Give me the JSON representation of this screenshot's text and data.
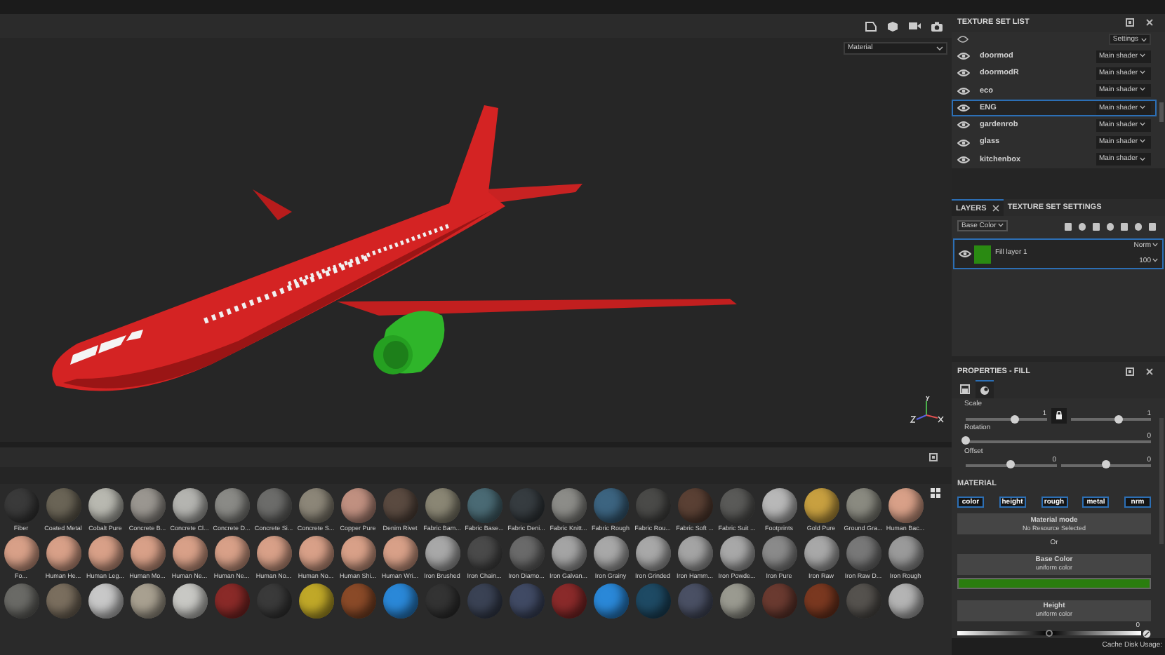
{
  "viewport": {
    "channel_select": "Material"
  },
  "texture_set_list": {
    "title": "TEXTURE SET LIST",
    "settings": "Settings",
    "items": [
      {
        "name": "doormod",
        "shader": "Main shader",
        "selected": false
      },
      {
        "name": "doormodR",
        "shader": "Main shader",
        "selected": false
      },
      {
        "name": "eco",
        "shader": "Main shader",
        "selected": false
      },
      {
        "name": "ENG",
        "shader": "Main shader",
        "selected": true
      },
      {
        "name": "gardenrob",
        "shader": "Main shader",
        "selected": false
      },
      {
        "name": "glass",
        "shader": "Main shader",
        "selected": false
      },
      {
        "name": "kitchenbox",
        "shader": "Main shader",
        "selected": false
      }
    ]
  },
  "layers": {
    "tabs": [
      {
        "label": "LAYERS",
        "selected": true
      },
      {
        "label": "TEXTURE SET SETTINGS",
        "selected": false
      }
    ],
    "channel": "Base Color",
    "items": [
      {
        "name": "Fill layer 1",
        "blend": "Norm",
        "opacity": "100",
        "selected": true,
        "color": "#2a8a12"
      }
    ]
  },
  "properties": {
    "title": "PROPERTIES - FILL",
    "params": [
      {
        "label": "Scale",
        "kind": "locked",
        "sliders": [
          {
            "reading": "1",
            "level": 0.6
          },
          {
            "reading": "1",
            "level": 0.6
          }
        ]
      },
      {
        "label": "Rotation",
        "kind": "single",
        "sliders": [
          {
            "reading": "0",
            "level": 0
          }
        ]
      },
      {
        "label": "Offset",
        "kind": "pair",
        "sliders": [
          {
            "reading": "0",
            "level": 0.5
          },
          {
            "reading": "0",
            "level": 0.5
          }
        ]
      }
    ],
    "material": {
      "title": "MATERIAL",
      "channels": [
        {
          "label": "color",
          "on": true
        },
        {
          "label": "height",
          "on": true
        },
        {
          "label": "rough",
          "on": true
        },
        {
          "label": "metal",
          "on": true
        },
        {
          "label": "nrm",
          "on": true
        }
      ],
      "mode": {
        "title": "Material mode",
        "value": "No Resource Selected"
      },
      "or": "Or",
      "base_color": {
        "title": "Base Color",
        "subtitle": "uniform color",
        "color": "#2a7d0e"
      },
      "height": {
        "title": "Height",
        "subtitle": "uniform color",
        "reading": "0",
        "level": 0.5
      }
    }
  },
  "shelf": {
    "rows": [
      [
        {
          "name": "Fiber",
          "color": "#3a3a3a"
        },
        {
          "name": "Coated Metal",
          "color": "#6a6456"
        },
        {
          "name": "Cobalt Pure",
          "color": "#b8b8b0"
        },
        {
          "name": "Concrete B...",
          "color": "#9a9690"
        },
        {
          "name": "Concrete Cl...",
          "color": "#b4b4b0"
        },
        {
          "name": "Concrete D...",
          "color": "#8a8a86"
        },
        {
          "name": "Concrete Si...",
          "color": "#6c6c6a"
        },
        {
          "name": "Concrete S...",
          "color": "#8c8678"
        },
        {
          "name": "Copper Pure",
          "color": "#c09080"
        },
        {
          "name": "Denim Rivet",
          "color": "#5a4a40"
        },
        {
          "name": "Fabric Bam...",
          "color": "#8a8674"
        },
        {
          "name": "Fabric Base...",
          "color": "#4a6a74"
        },
        {
          "name": "Fabric Deni...",
          "color": "#363c40"
        },
        {
          "name": "Fabric Knitt...",
          "color": "#8c8c88"
        },
        {
          "name": "Fabric Rough",
          "color": "#3c6480"
        },
        {
          "name": "Fabric Rou...",
          "color": "#4a4a48"
        },
        {
          "name": "Fabric Soft ...",
          "color": "#5a4034"
        },
        {
          "name": "Fabric Suit ...",
          "color": "#5a5a58"
        },
        {
          "name": "Footprints",
          "color": "#b8b8b8"
        },
        {
          "name": "Gold Pure",
          "color": "#c8a040"
        },
        {
          "name": "Ground Gra...",
          "color": "#8a8a80"
        },
        {
          "name": "Human Bac...",
          "color": "#d8a088"
        }
      ],
      [
        {
          "name": "Fo...",
          "color": "#d8a088"
        },
        {
          "name": "Human He...",
          "color": "#d8a088"
        },
        {
          "name": "Human Leg...",
          "color": "#d8a088"
        },
        {
          "name": "Human Mo...",
          "color": "#d8a088"
        },
        {
          "name": "Human Ne...",
          "color": "#d8a088"
        },
        {
          "name": "Human Ne...",
          "color": "#d8a088"
        },
        {
          "name": "Human No...",
          "color": "#d8a088"
        },
        {
          "name": "Human No...",
          "color": "#d8a088"
        },
        {
          "name": "Human Shi...",
          "color": "#d8a088"
        },
        {
          "name": "Human Wri...",
          "color": "#d8a088"
        },
        {
          "name": "Iron Brushed",
          "color": "#a8a8a8"
        },
        {
          "name": "Iron Chain...",
          "color": "#4a4a4a"
        },
        {
          "name": "Iron Diamo...",
          "color": "#6a6a6a"
        },
        {
          "name": "Iron Galvan...",
          "color": "#a4a4a4"
        },
        {
          "name": "Iron Grainy",
          "color": "#a8a8a8"
        },
        {
          "name": "Iron Grinded",
          "color": "#a8a8a8"
        },
        {
          "name": "Iron Hamm...",
          "color": "#a4a4a4"
        },
        {
          "name": "Iron Powde...",
          "color": "#a8a8a8"
        },
        {
          "name": "Iron Pure",
          "color": "#8a8a8a"
        },
        {
          "name": "Iron Raw",
          "color": "#a8a8a8"
        },
        {
          "name": "Iron Raw D...",
          "color": "#787878"
        },
        {
          "name": "Iron Rough",
          "color": "#9a9a9a"
        }
      ],
      [
        {
          "color": "#6a6a66"
        },
        {
          "color": "#7a6e5e"
        },
        {
          "color": "#c8c8c8"
        },
        {
          "color": "#a8a090"
        },
        {
          "color": "#c8c8c4"
        },
        {
          "color": "#8a2a28"
        },
        {
          "color": "#3a3a3a"
        },
        {
          "color": "#c0a828"
        },
        {
          "color": "#8a4a28"
        },
        {
          "color": "#2a88d8"
        },
        {
          "color": "#333333"
        },
        {
          "color": "#3a4254"
        },
        {
          "color": "#404a64"
        },
        {
          "color": "#8a2a2a"
        },
        {
          "color": "#2a88d8"
        },
        {
          "color": "#1e4a64"
        },
        {
          "color": "#4a5064"
        },
        {
          "color": "#9a9a90"
        },
        {
          "color": "#6a3a30"
        },
        {
          "color": "#7a3820"
        },
        {
          "color": "#55524e"
        },
        {
          "color": "#b4b4b4"
        }
      ]
    ]
  },
  "status_bar": {
    "cache": "Cache Disk Usage:"
  }
}
